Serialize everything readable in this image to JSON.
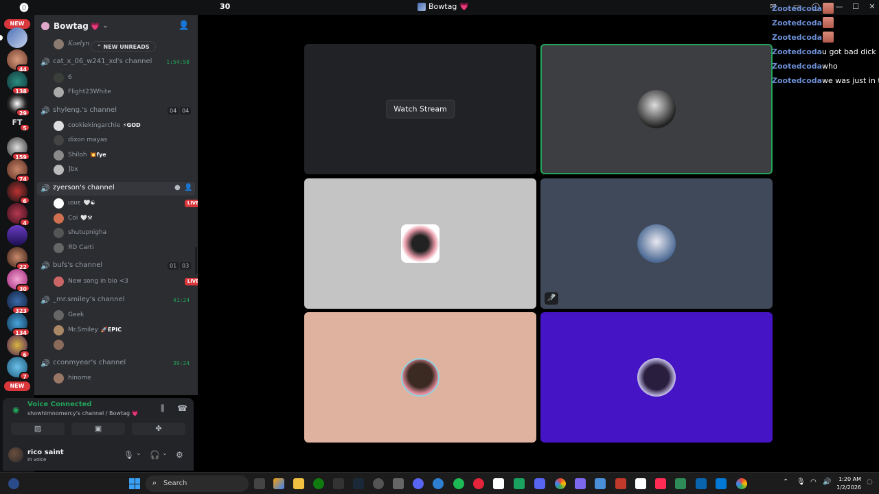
{
  "titlebar": {
    "count": "30",
    "title": "Bowtag",
    "heart": "💗"
  },
  "rail": {
    "new_top": "NEW",
    "new_bottom": "NEW",
    "ft_label": "FT",
    "badges": [
      "44",
      "138",
      "29",
      "5",
      "159",
      "74",
      "6",
      "4",
      "22",
      "30",
      "323",
      "134",
      "6",
      "7"
    ]
  },
  "guild": {
    "name": "Bowtag",
    "heart": "💗",
    "new_unreads": "NEW UNREADS",
    "partial_user": "Kaelyn"
  },
  "channels": [
    {
      "name": "cat_x_06_w241_xd's channel",
      "time": "1:54:58",
      "users": [
        {
          "name": "6",
          "tag": ""
        },
        {
          "name": "Flight23White",
          "tag": ""
        }
      ]
    },
    {
      "name": "shyleng.'s channel",
      "limit_a": "04",
      "limit_b": "04",
      "users": [
        {
          "name": "cookiekingarchie",
          "tag": "⚡GOD"
        },
        {
          "name": "dixon mayas",
          "tag": ""
        },
        {
          "name": "Shiloh",
          "tag": "💥fye"
        },
        {
          "name": "]bx",
          "tag": ""
        }
      ]
    },
    {
      "name": "zyerson's channel",
      "active": true,
      "users": [
        {
          "name": "ιουε",
          "tag": "🤍☯",
          "live": "LIVE"
        },
        {
          "name": "Coi",
          "tag": "🤍⚒"
        },
        {
          "name": "shutupnigha",
          "tag": ""
        },
        {
          "name": "ЯD Carti",
          "tag": ""
        }
      ]
    },
    {
      "name": "bufs's channel",
      "limit_a": "01",
      "limit_b": "03",
      "users": [
        {
          "name": "New song in bio <3",
          "tag": "",
          "live": "LIVE"
        }
      ]
    },
    {
      "name": "_mr.smiley's channel",
      "time": "41:24",
      "users": [
        {
          "name": "Geek",
          "tag": ""
        },
        {
          "name": "Mr.Smiley",
          "tag": "🚀EPIC"
        },
        {
          "name": "",
          "tag": ""
        }
      ]
    },
    {
      "name": "cconmyear's channel",
      "time": "39:24",
      "users": [
        {
          "name": "hinome",
          "tag": ""
        }
      ]
    }
  ],
  "voice": {
    "status": "Voice Connected",
    "location": "showhimnomercy's channel / Bowtag 💗"
  },
  "me": {
    "name": "rico saint",
    "status": "In voice"
  },
  "stage": {
    "watch_stream": "Watch Stream",
    "tile_colors": [
      "#212225",
      "#3d3e42",
      "#c4c4c4",
      "#40495a",
      "#deb29e",
      "#4514c4"
    ],
    "speaking_color": "#23a55a"
  },
  "overlay": [
    {
      "user": "Zootedcoda",
      "msg": "",
      "emote": true
    },
    {
      "user": "Zootedcoda",
      "msg": "",
      "emote": true
    },
    {
      "user": "Zootedcoda",
      "msg": "",
      "emote": true
    },
    {
      "user": "Zootedcoda",
      "msg": "u got bad dick"
    },
    {
      "user": "Zootedcoda",
      "msg": "who"
    },
    {
      "user": "Zootedcoda",
      "msg": "we was just in th"
    }
  ],
  "taskbar": {
    "search": "Search",
    "time": "1:20 AM",
    "date": "1/2/2026"
  }
}
